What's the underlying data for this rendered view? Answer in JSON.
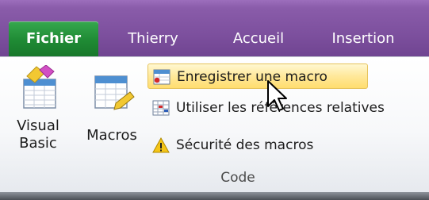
{
  "tabs": {
    "file": "Fichier",
    "thierry": "Thierry",
    "accueil": "Accueil",
    "insertion": "Insertion"
  },
  "code_group": {
    "visual_basic_label": "Visual\nBasic",
    "macros_label": "Macros",
    "record_macro_label": "Enregistrer une macro",
    "relative_refs_label": "Utiliser les références relatives",
    "macro_security_label": "Sécurité des macros",
    "group_label": "Code"
  },
  "icons": {
    "visual_basic": "visual-basic-icon",
    "macros": "macros-icon",
    "record_macro": "record-macro-icon",
    "relative_refs": "relative-references-icon",
    "macro_security": "warning-icon",
    "cursor": "mouse-cursor-icon"
  },
  "colors": {
    "tabbar": "#7c4f9d",
    "file_tab": "#1f8a34",
    "hover_highlight": "#ffe89a"
  }
}
